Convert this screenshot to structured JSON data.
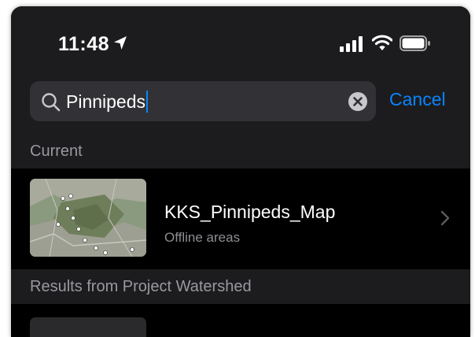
{
  "status_bar": {
    "time": "11:48",
    "icons": [
      "location-arrow-icon",
      "cellular-signal-icon",
      "wifi-icon",
      "battery-icon"
    ]
  },
  "search": {
    "query": "Pinnipeds",
    "cancel_label": "Cancel",
    "icons": [
      "search-icon",
      "clear-icon"
    ]
  },
  "sections": {
    "current_header": "Current",
    "results_header": "Results from Project Watershed"
  },
  "current_map": {
    "title": "KKS_Pinnipeds_Map",
    "subtitle": "Offline areas",
    "thumbnail": "satellite-map-thumbnail",
    "accessory": "chevron-right-icon"
  },
  "colors": {
    "background": "#000000",
    "bar": "#1c1c1e",
    "field": "#323236",
    "accent": "#0a84ff",
    "secondary_text": "#8e8e93"
  }
}
